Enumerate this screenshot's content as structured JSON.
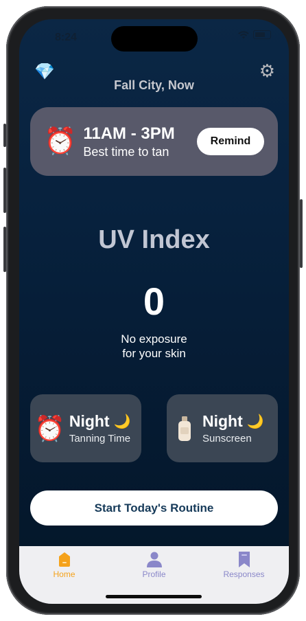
{
  "status": {
    "time": "8:24"
  },
  "header": {
    "location": "Fall City, Now",
    "gem_icon": "gem-icon",
    "settings_icon": "gear-icon"
  },
  "tanning_card": {
    "time_range": "11AM - 3PM",
    "subtitle": "Best time to tan",
    "remind_label": "Remind",
    "icon": "alarm-clock-icon"
  },
  "uv": {
    "title": "UV Index",
    "value": "0",
    "desc_line1": "No exposure",
    "desc_line2": "for your skin"
  },
  "mini_cards": [
    {
      "title": "Night",
      "subtitle": "Tanning Time",
      "icon": "alarm-clock-icon"
    },
    {
      "title": "Night",
      "subtitle": "Sunscreen",
      "icon": "lotion-bottle-icon"
    }
  ],
  "routine_button": {
    "label": "Start Today's Routine"
  },
  "tabs": [
    {
      "label": "Home",
      "active": true,
      "color": "#f5a21b"
    },
    {
      "label": "Profile",
      "active": false,
      "color": "#8a87c9"
    },
    {
      "label": "Responses",
      "active": false,
      "color": "#8a87c9"
    }
  ]
}
